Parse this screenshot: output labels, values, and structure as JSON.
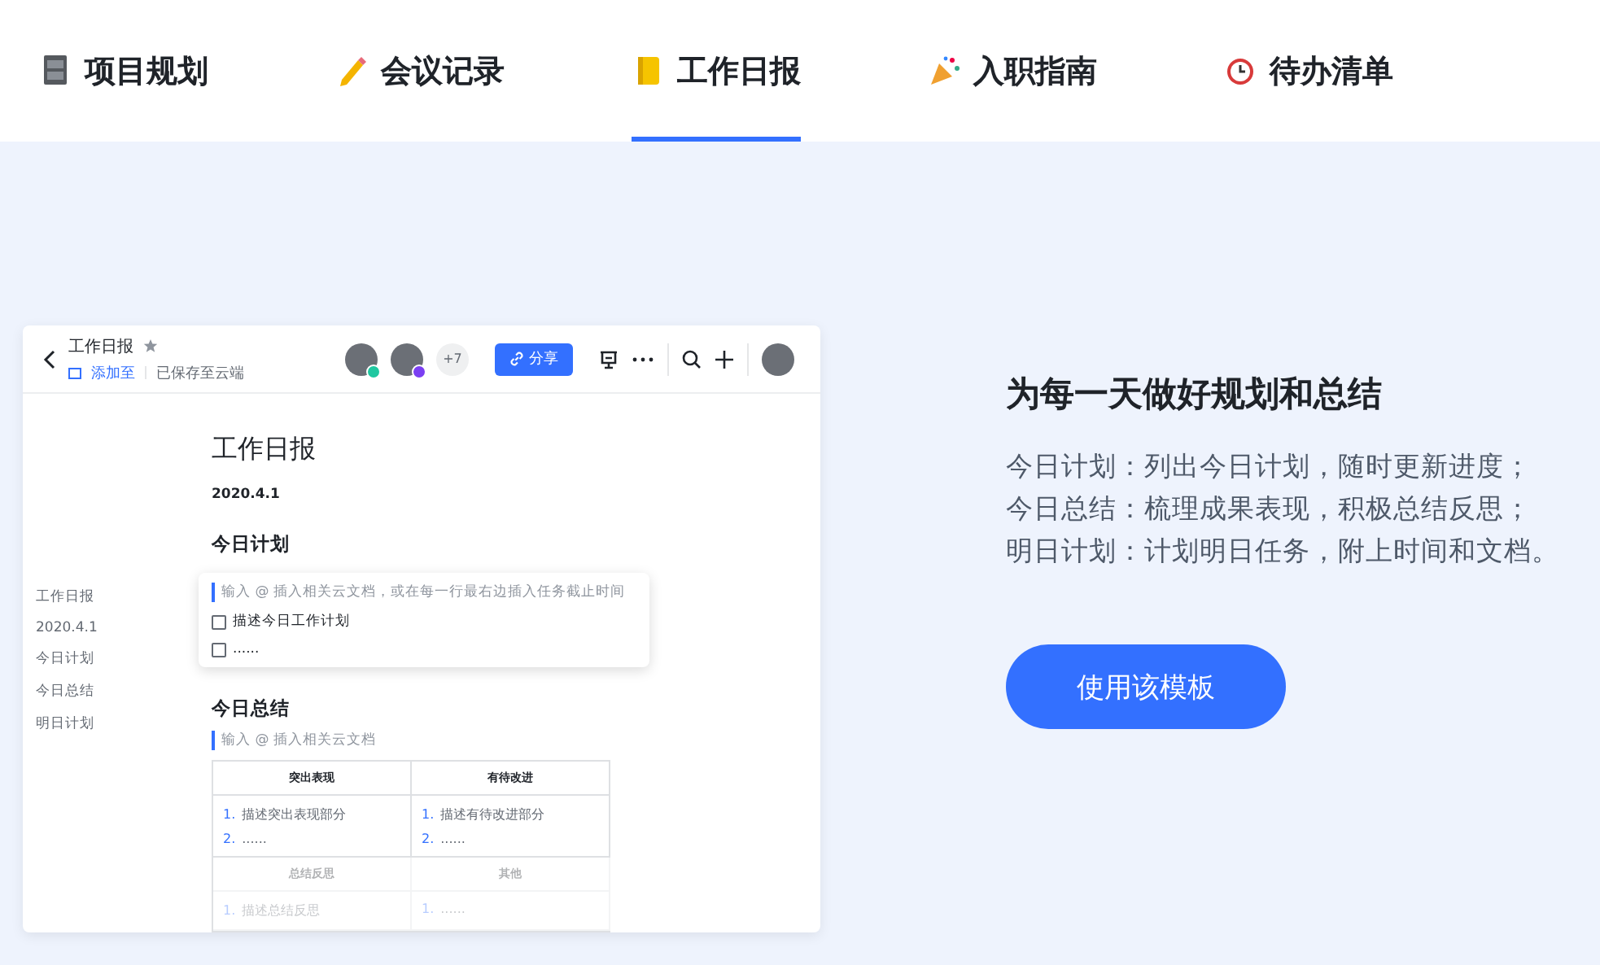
{
  "tabs": [
    {
      "label": "项目规划",
      "selected": false
    },
    {
      "label": "会议记录",
      "selected": false
    },
    {
      "label": "工作日报",
      "selected": true
    },
    {
      "label": "入职指南",
      "selected": false
    },
    {
      "label": "待办清单",
      "selected": false
    }
  ],
  "doc": {
    "title": "工作日报",
    "add_to": "添加至",
    "saved": "已保存至云端",
    "collaborators": [
      {
        "color": "#1fc7a0"
      },
      {
        "color": "#7b3ff2"
      }
    ],
    "more_count": "+7",
    "share": "分享",
    "outline": [
      "工作日报",
      "2020.4.1",
      "今日计划",
      "今日总结",
      "明日计划"
    ],
    "heading": "工作日报",
    "date": "2020.4.1",
    "plan": {
      "title": "今日计划",
      "hint": "输入 @ 插入相关云文档，或在每一行最右边插入任务截止时间",
      "tasks": [
        {
          "text": "描述今日工作计划",
          "checked": false
        },
        {
          "text": "......",
          "checked": false
        }
      ]
    },
    "summary": {
      "title": "今日总结",
      "hint": "输入 @ 插入相关云文档",
      "table": [
        {
          "kind": "header",
          "faded": false,
          "cells": [
            "突出表现",
            "有待改进"
          ]
        },
        {
          "kind": "list",
          "faded": false,
          "cells": [
            [
              {
                "n": "1.",
                "t": "描述突出表现部分"
              },
              {
                "n": "2.",
                "t": "......"
              }
            ],
            [
              {
                "n": "1.",
                "t": "描述有待改进部分"
              },
              {
                "n": "2.",
                "t": "......"
              }
            ]
          ]
        },
        {
          "kind": "header",
          "faded": true,
          "cells": [
            "总结反思",
            "其他"
          ]
        },
        {
          "kind": "list",
          "faded": true,
          "cells": [
            [
              {
                "n": "1.",
                "t": "描述总结反思"
              }
            ],
            [
              {
                "n": "1.",
                "t": "......"
              }
            ]
          ]
        }
      ]
    }
  },
  "feature": {
    "title": "为每一天做好规划和总结",
    "lines": [
      "今日计划：列出今日计划，随时更新进度；",
      "今日总结：梳理成果表现，积极总结反思；",
      "明日计划：计划明日任务，附上时间和文档。"
    ],
    "button": "使用该模板"
  }
}
